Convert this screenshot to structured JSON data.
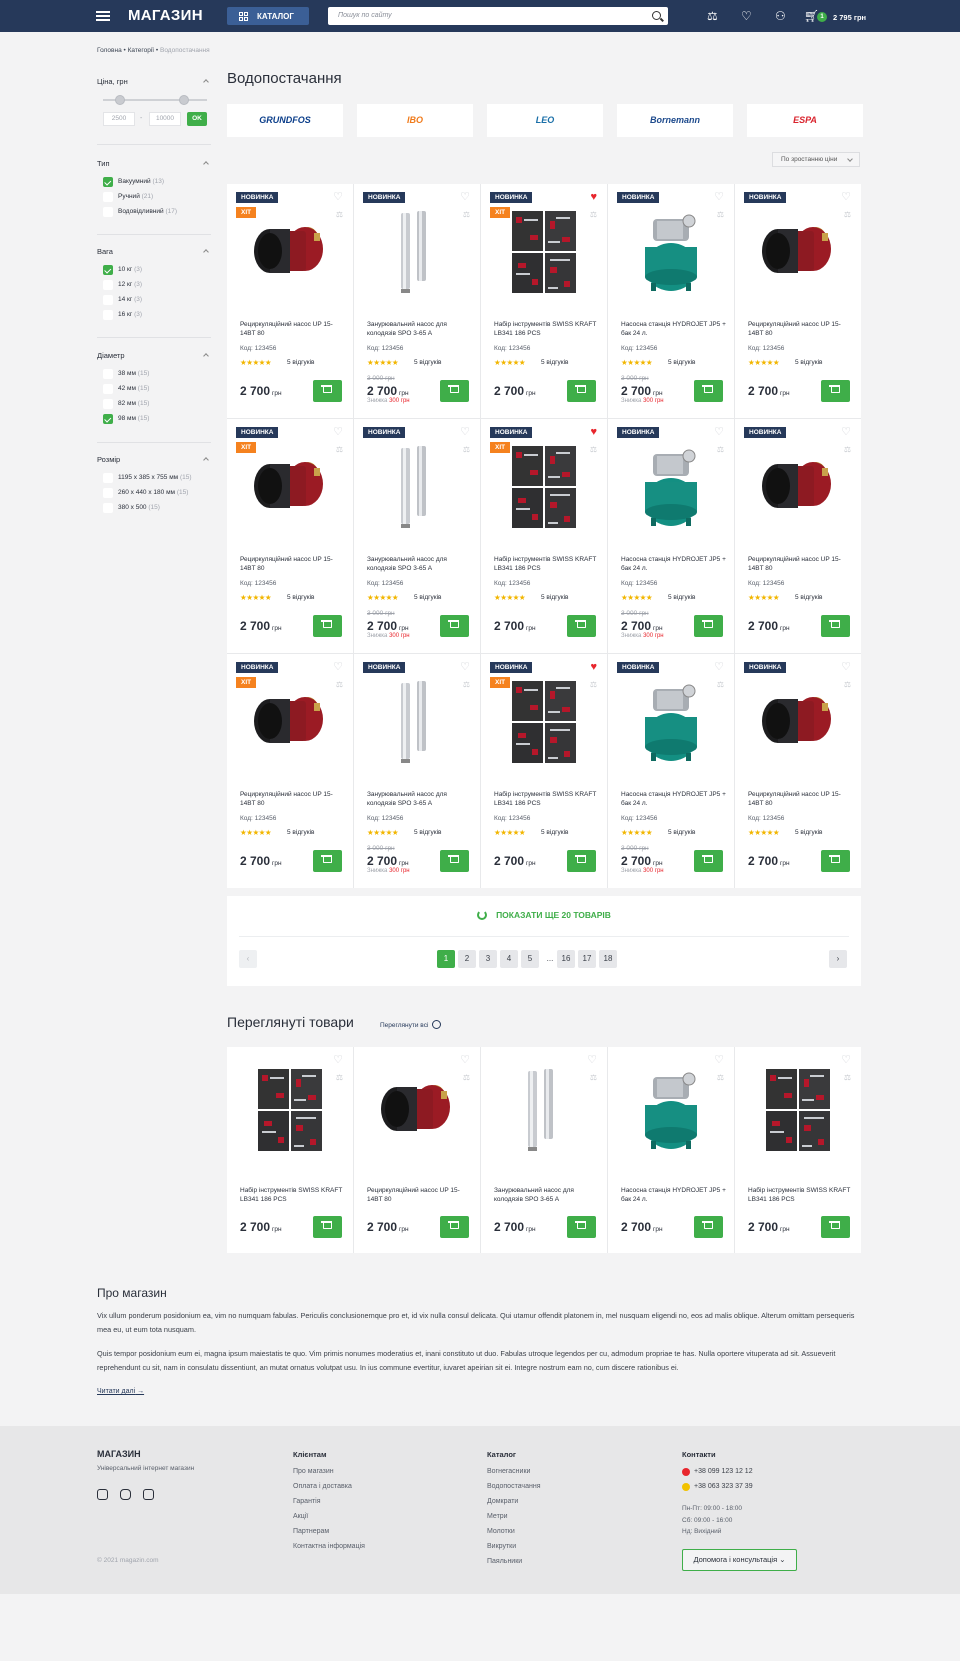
{
  "header": {
    "logo": "МАГАЗИН",
    "catalog_label": "КАТАЛОГ",
    "search_placeholder": "Пошук по сайту",
    "cart_count": "1",
    "cart_total": "2 795 грн"
  },
  "breadcrumb": {
    "home": "Головна",
    "category": "Категорії",
    "current": "Водопостачання"
  },
  "filters": {
    "price": {
      "title": "Ціна, грн",
      "min": "2500",
      "max": "10000",
      "ok": "OK"
    },
    "type": {
      "title": "Тип",
      "options": [
        {
          "label": "Вакуумний",
          "count": "(13)",
          "checked": true
        },
        {
          "label": "Ручний",
          "count": "(21)",
          "checked": false
        },
        {
          "label": "Водовідливний",
          "count": "(17)",
          "checked": false
        }
      ]
    },
    "weight": {
      "title": "Вага",
      "options": [
        {
          "label": "10 кг",
          "count": "(3)",
          "checked": true
        },
        {
          "label": "12 кг",
          "count": "(3)",
          "checked": false
        },
        {
          "label": "14 кг",
          "count": "(3)",
          "checked": false
        },
        {
          "label": "16 кг",
          "count": "(3)",
          "checked": false
        }
      ]
    },
    "diameter": {
      "title": "Діаметр",
      "options": [
        {
          "label": "38 мм",
          "count": "(15)",
          "checked": false
        },
        {
          "label": "42 мм",
          "count": "(15)",
          "checked": false
        },
        {
          "label": "82 мм",
          "count": "(15)",
          "checked": false
        },
        {
          "label": "98 мм",
          "count": "(15)",
          "checked": true
        }
      ]
    },
    "size": {
      "title": "Розмір",
      "options": [
        {
          "label": "1195 x 385 x 755 мм",
          "count": "(15)",
          "checked": false
        },
        {
          "label": "260 x 440 x 180 мм",
          "count": "(15)",
          "checked": false
        },
        {
          "label": "380 x 500",
          "count": "(15)",
          "checked": false
        }
      ]
    }
  },
  "page_title": "Водопостачання",
  "brands": [
    {
      "name": "GRUNDFOS",
      "color": "#0b3e8a"
    },
    {
      "name": "IBO",
      "color": "#f07a1a"
    },
    {
      "name": "LEO",
      "color": "#1a6fa8"
    },
    {
      "name": "Bornemann",
      "color": "#1d4a8c"
    },
    {
      "name": "ESPA",
      "color": "#d9232d"
    }
  ],
  "sort_label": "По зростанню ціни",
  "labels": {
    "new": "НОВИНКА",
    "hit": "ХІТ",
    "code_prefix": "Код: ",
    "reviews": "5 відгуків",
    "currency": "грн",
    "discount_prefix": "Знижка",
    "stars": "★★★★★"
  },
  "products": [
    {
      "name": "Рециркуляційний насос UP 15-14BT 80",
      "code": "123456",
      "price": "2 700",
      "old_price": "",
      "discount": "",
      "hit": true,
      "fav": false,
      "img": "pump"
    },
    {
      "name": "Занурювальний насос для колодязів SPO 3-65 A",
      "code": "123456",
      "price": "2 700",
      "old_price": "3 000 грн",
      "discount": "300 грн",
      "hit": false,
      "fav": false,
      "img": "deep"
    },
    {
      "name": "Набір інструментів SWISS KRAFT LB341 186 PCS",
      "code": "123456",
      "price": "2 700",
      "old_price": "",
      "discount": "",
      "hit": true,
      "fav": true,
      "img": "tools"
    },
    {
      "name": "Насосна станція HYDROJET JP5 + бак 24 л.",
      "code": "123456",
      "price": "2 700",
      "old_price": "3 000 грн",
      "discount": "300 грн",
      "hit": false,
      "fav": false,
      "img": "station"
    },
    {
      "name": "Рециркуляційний насос UP 15-14BT 80",
      "code": "123456",
      "price": "2 700",
      "old_price": "",
      "discount": "",
      "hit": false,
      "fav": false,
      "img": "pump"
    }
  ],
  "load_more": "ПОКАЗАТИ ЩЕ 20 ТОВАРІВ",
  "pagination": [
    "1",
    "2",
    "3",
    "4",
    "5",
    "...",
    "16",
    "17",
    "18"
  ],
  "recent": {
    "title": "Переглянуті товари",
    "view_all": "Переглянути всі",
    "items": [
      {
        "name": "Набір інструментів SWISS KRAFT LB341 186 PCS",
        "price": "2 700",
        "img": "tools"
      },
      {
        "name": "Рециркуляційний насос UP 15-14BT 80",
        "price": "2 700",
        "img": "pump"
      },
      {
        "name": "Занурювальний насос для колодязів SPO 3-65 A",
        "price": "2 700",
        "img": "deep"
      },
      {
        "name": "Насосна станція HYDROJET JP5 + бак 24 л.",
        "price": "2 700",
        "img": "station"
      },
      {
        "name": "Набір інструментів SWISS KRAFT LB341 186 PCS",
        "price": "2 700",
        "img": "tools"
      }
    ]
  },
  "about": {
    "title": "Про магазин",
    "p1": "Vix ullum ponderum posidonium ea, vim no numquam fabulas. Periculis conclusionemque pro et, id vix nulla consul delicata. Qui utamur offendit platonem in, mel nusquam eligendi no, eos ad malis oblique. Alterum omittam persequeris mea eu, ut eum tota nusquam.",
    "p2": "Quis tempor posidonium eum ei, magna ipsum maiestatis te quo. Vim primis nonumes moderatius et, inani constituto ut duo. Fabulas utroque legendos per cu, admodum propriae te has. Nulla oportere vituperata ad sit. Assueverit reprehendunt cu sit, nam in consulatu dissentiunt, an mutat ornatus volutpat usu. In ius commune evertitur, iuvaret apeirian sit ei. Integre nostrum eam no, cum discere rationibus ei.",
    "read_more": "Читати далі"
  },
  "footer": {
    "logo": "МАГАЗИН",
    "subtitle": "Універсальний інтернет магазин",
    "copyright": "© 2021 magazin.com",
    "clients": {
      "title": "Клієнтам",
      "links": [
        "Про магазин",
        "Оплата і доставка",
        "Гарантія",
        "Акції",
        "Партнерам",
        "Контактна інформація"
      ]
    },
    "catalog": {
      "title": "Каталог",
      "links": [
        "Вогнегасники",
        "Водопостачання",
        "Домкрати",
        "Метри",
        "Молотки",
        "Викрутки",
        "Паяльники"
      ]
    },
    "contacts": {
      "title": "Контакти",
      "phone1": "+38 099 123 12 12",
      "phone2": "+38 063 323 37 39",
      "hours1": "Пн-Пт: 09:00 - 18:00",
      "hours2": "Сб: 09:00 - 16:00",
      "hours3": "Нд: Вихідний",
      "help": "Допомога і консультація"
    }
  },
  "colors": {
    "header": "#26395a",
    "accent_green": "#3fae49",
    "badge_orange": "#f5821f",
    "favorite_red": "#e8262d"
  }
}
